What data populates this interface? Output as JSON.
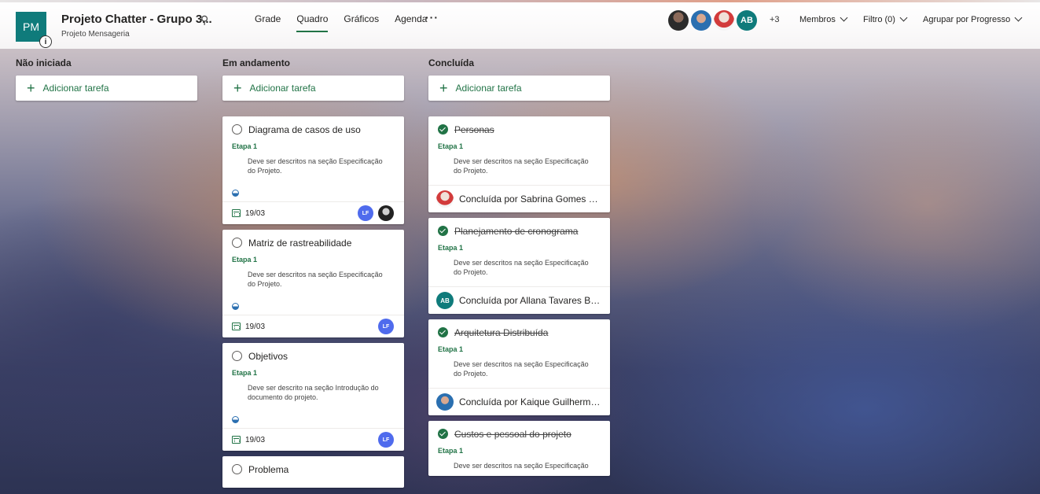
{
  "header": {
    "plan_initials": "PM",
    "plan_title": "Projeto Chatter - Grupo 3...",
    "plan_group": "Projeto Mensageria",
    "info_glyph": "i",
    "pin_glyph": "⚲",
    "nav_tabs": [
      "Grade",
      "Quadro",
      "Gráficos",
      "Agenda"
    ],
    "active_tab": "Quadro",
    "more_glyph": "···",
    "member_initials": "AB",
    "member_extra": "+3",
    "members_label": "Membros",
    "filter_label": "Filtro (0)",
    "group_by_label": "Agrupar por Progresso"
  },
  "columns": [
    {
      "title": "Não iniciada",
      "add_label": "Adicionar tarefa",
      "cards": []
    },
    {
      "title": "Em andamento",
      "add_label": "Adicionar tarefa",
      "cards": [
        {
          "title": "Diagrama de casos de uso",
          "bucket": "Etapa 1",
          "desc": "Deve ser descritos na seção Especificação do Projeto.",
          "due": "19/03",
          "assignees": [
            "LF",
            "photo"
          ]
        },
        {
          "title": "Matriz de rastreabilidade",
          "bucket": "Etapa 1",
          "desc": "Deve ser descritos na seção Especificação do Projeto.",
          "due": "19/03",
          "assignees": [
            "LF"
          ]
        },
        {
          "title": "Objetivos",
          "bucket": "Etapa 1",
          "desc": "Deve ser descrito na seção Introdução do documento do projeto.",
          "due": "19/03",
          "assignees": [
            "LF"
          ]
        },
        {
          "title": "Problema"
        }
      ]
    },
    {
      "title": "Concluída",
      "add_label": "Adicionar tarefa",
      "cards": [
        {
          "title": "Personas",
          "bucket": "Etapa 1",
          "desc": "Deve ser descritos na seção Especificação do Projeto.",
          "completed_by": "Concluída por Sabrina Gomes Sil..."
        },
        {
          "title": "Planejamento de cronograma",
          "bucket": "Etapa 1",
          "desc": "Deve ser descritos na seção Especificação do Projeto.",
          "completed_by": "Concluída por Allana Tavares Bas...",
          "avatar_initials": "AB"
        },
        {
          "title": "Arquitetura Distribuída",
          "bucket": "Etapa 1",
          "desc": "Deve ser descritos na seção Especificação do Projeto.",
          "completed_by": "Concluída por Kaique Guilherme ..."
        },
        {
          "title": "Custos e pessoal do projeto",
          "bucket": "Etapa 1",
          "desc": "Deve ser descritos na seção Especificação"
        }
      ]
    }
  ],
  "colors": {
    "accent": "#217346",
    "plan_tile": "#0f7b7b",
    "avatar_lf": "#4f6bed"
  }
}
